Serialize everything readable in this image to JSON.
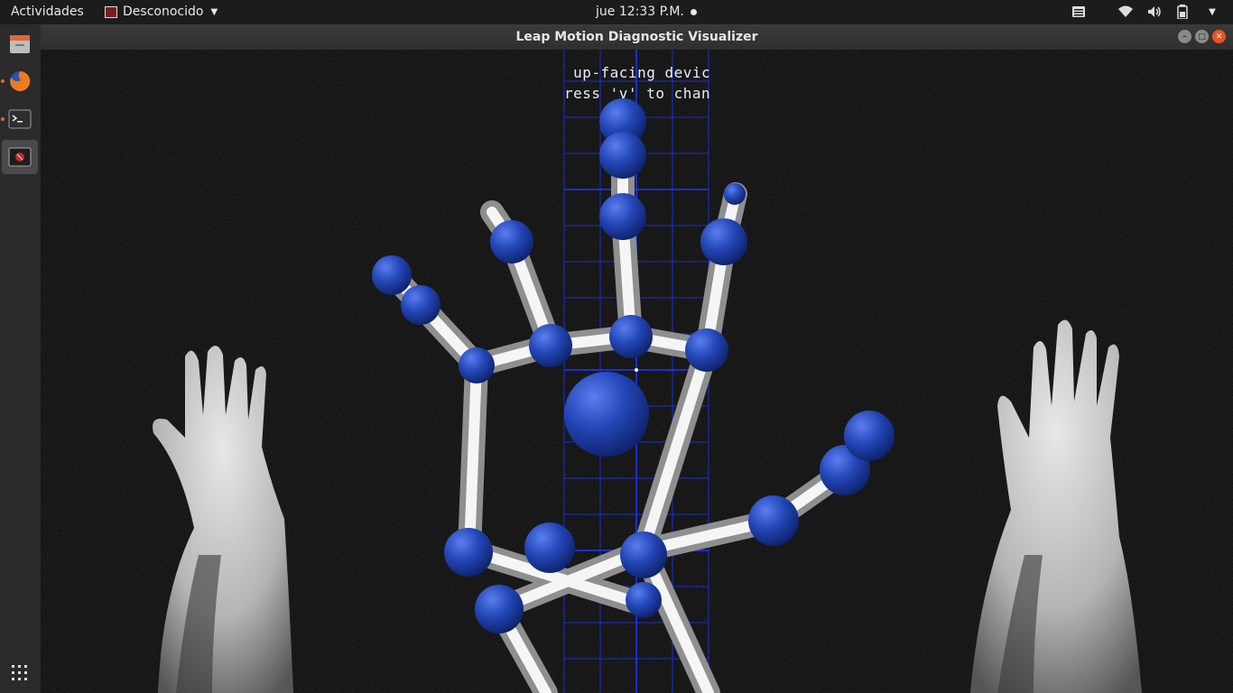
{
  "topbar": {
    "activities": "Actividades",
    "app_name": "Desconocido",
    "clock": "jue 12:33 P.M."
  },
  "dock": {
    "items": [
      {
        "name": "files-icon"
      },
      {
        "name": "firefox-icon"
      },
      {
        "name": "terminal-icon"
      },
      {
        "name": "leap-visualizer-icon"
      }
    ]
  },
  "window": {
    "title": "Leap Motion Diagnostic Visualizer"
  },
  "viewport": {
    "line1": " up-facing devic",
    "line2": "ress 'v' to chan"
  },
  "colors": {
    "joint": "#1f3f9f",
    "bone": "#e6e6e6",
    "grid": "#1a2fd0",
    "accent": "#e95420"
  }
}
